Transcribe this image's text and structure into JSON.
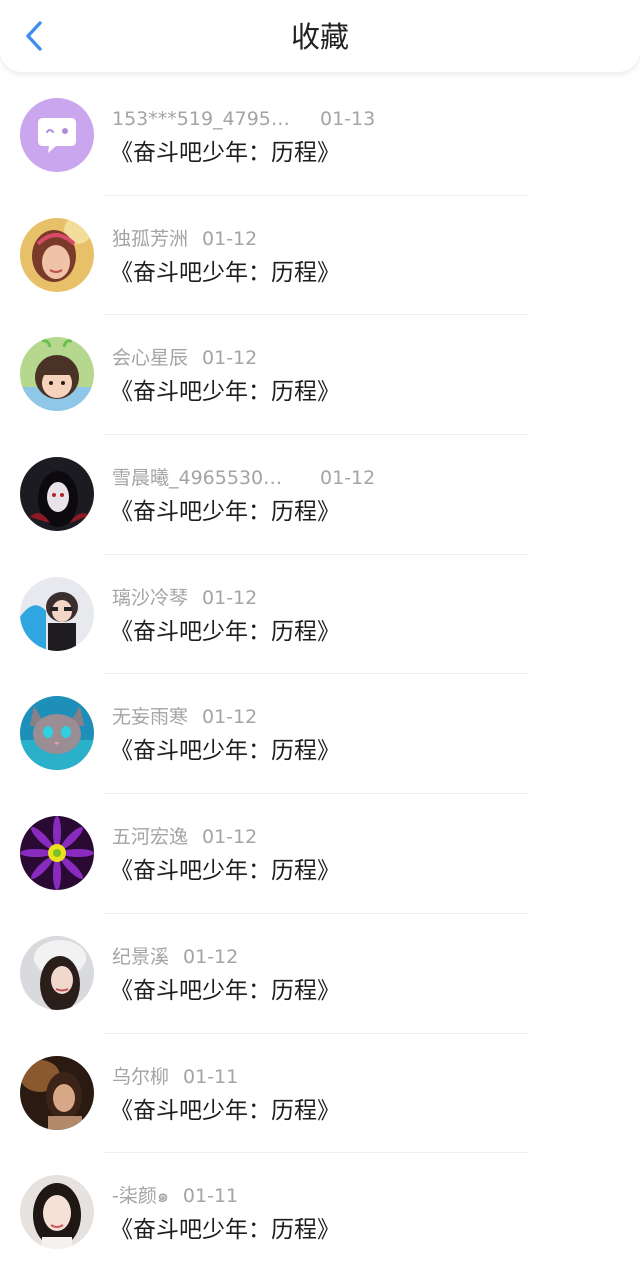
{
  "header": {
    "title": "收藏"
  },
  "favorites": [
    {
      "name": "153***519_4795…",
      "date": "01-13",
      "content": "《奋斗吧少年：历程》"
    },
    {
      "name": "独孤芳洲",
      "date": "01-12",
      "content": "《奋斗吧少年：历程》"
    },
    {
      "name": "会心星辰",
      "date": "01-12",
      "content": "《奋斗吧少年：历程》"
    },
    {
      "name": "雪晨曦_4965530…",
      "date": "01-12",
      "content": "《奋斗吧少年：历程》"
    },
    {
      "name": "璃沙冷琴",
      "date": "01-12",
      "content": "《奋斗吧少年：历程》"
    },
    {
      "name": "无妄雨寒",
      "date": "01-12",
      "content": "《奋斗吧少年：历程》"
    },
    {
      "name": "五河宏逸",
      "date": "01-12",
      "content": "《奋斗吧少年：历程》"
    },
    {
      "name": "纪景溪",
      "date": "01-12",
      "content": "《奋斗吧少年：历程》"
    },
    {
      "name": "乌尔柳",
      "date": "01-11",
      "content": "《奋斗吧少年：历程》"
    },
    {
      "name": "-柒颜๑",
      "date": "01-11",
      "content": "《奋斗吧少年：历程》"
    }
  ],
  "colors": {
    "accent": "#3d8ef0",
    "default_avatar": "#c9a6ee"
  }
}
